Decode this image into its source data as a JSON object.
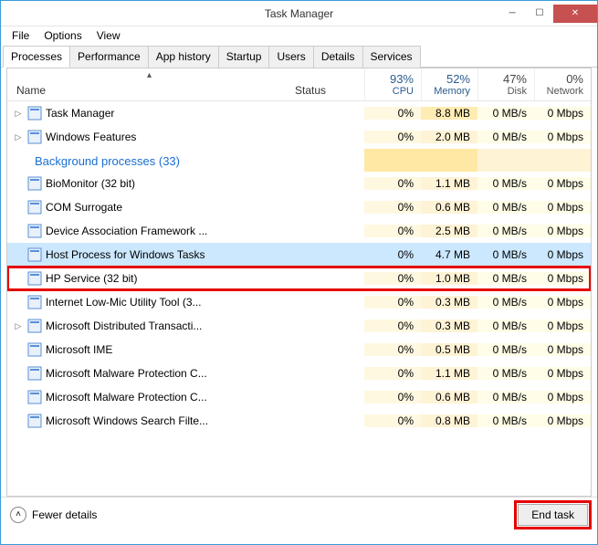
{
  "window": {
    "title": "Task Manager"
  },
  "menu": {
    "file": "File",
    "options": "Options",
    "view": "View"
  },
  "tabs": {
    "processes": "Processes",
    "performance": "Performance",
    "apphistory": "App history",
    "startup": "Startup",
    "users": "Users",
    "details": "Details",
    "services": "Services"
  },
  "columns": {
    "name": "Name",
    "status": "Status",
    "cpu": {
      "pct": "93%",
      "label": "CPU"
    },
    "memory": {
      "pct": "52%",
      "label": "Memory"
    },
    "disk": {
      "pct": "47%",
      "label": "Disk"
    },
    "network": {
      "pct": "0%",
      "label": "Network"
    }
  },
  "group": {
    "bg_label": "Background processes",
    "bg_count": "(33)"
  },
  "rows": [
    {
      "name": "Task Manager",
      "expandable": true,
      "cpu": "0%",
      "mem": "8.8 MB",
      "disk": "0 MB/s",
      "net": "0 Mbps",
      "mem_bg": "bg-mem"
    },
    {
      "name": "Windows Features",
      "expandable": true,
      "cpu": "0%",
      "mem": "2.0 MB",
      "disk": "0 MB/s",
      "net": "0 Mbps",
      "mem_bg": "bg-mem-light"
    },
    {
      "name": "BioMonitor (32 bit)",
      "expandable": false,
      "cpu": "0%",
      "mem": "1.1 MB",
      "disk": "0 MB/s",
      "net": "0 Mbps",
      "mem_bg": "bg-mem-light"
    },
    {
      "name": "COM Surrogate",
      "expandable": false,
      "cpu": "0%",
      "mem": "0.6 MB",
      "disk": "0 MB/s",
      "net": "0 Mbps",
      "mem_bg": "bg-mem-light"
    },
    {
      "name": "Device Association Framework ...",
      "expandable": false,
      "cpu": "0%",
      "mem": "2.5 MB",
      "disk": "0 MB/s",
      "net": "0 Mbps",
      "mem_bg": "bg-mem-light"
    },
    {
      "name": "Host Process for Windows Tasks",
      "expandable": false,
      "cpu": "0%",
      "mem": "4.7 MB",
      "disk": "0 MB/s",
      "net": "0 Mbps",
      "mem_bg": "bg-mem",
      "selected": true
    },
    {
      "name": "HP Service (32 bit)",
      "expandable": false,
      "cpu": "0%",
      "mem": "1.0 MB",
      "disk": "0 MB/s",
      "net": "0 Mbps",
      "mem_bg": "bg-mem-light",
      "highlight": true
    },
    {
      "name": "Internet Low-Mic Utility Tool (3...",
      "expandable": false,
      "cpu": "0%",
      "mem": "0.3 MB",
      "disk": "0 MB/s",
      "net": "0 Mbps",
      "mem_bg": "bg-mem-light"
    },
    {
      "name": "Microsoft Distributed Transacti...",
      "expandable": true,
      "cpu": "0%",
      "mem": "0.3 MB",
      "disk": "0 MB/s",
      "net": "0 Mbps",
      "mem_bg": "bg-mem-light"
    },
    {
      "name": "Microsoft IME",
      "expandable": false,
      "cpu": "0%",
      "mem": "0.5 MB",
      "disk": "0 MB/s",
      "net": "0 Mbps",
      "mem_bg": "bg-mem-light"
    },
    {
      "name": "Microsoft Malware Protection C...",
      "expandable": false,
      "cpu": "0%",
      "mem": "1.1 MB",
      "disk": "0 MB/s",
      "net": "0 Mbps",
      "mem_bg": "bg-mem-light"
    },
    {
      "name": "Microsoft Malware Protection C...",
      "expandable": false,
      "cpu": "0%",
      "mem": "0.6 MB",
      "disk": "0 MB/s",
      "net": "0 Mbps",
      "mem_bg": "bg-mem-light"
    },
    {
      "name": "Microsoft Windows Search Filte...",
      "expandable": false,
      "cpu": "0%",
      "mem": "0.8 MB",
      "disk": "0 MB/s",
      "net": "0 Mbps",
      "mem_bg": "bg-mem-light"
    }
  ],
  "footer": {
    "fewer": "Fewer details",
    "endtask": "End task"
  }
}
